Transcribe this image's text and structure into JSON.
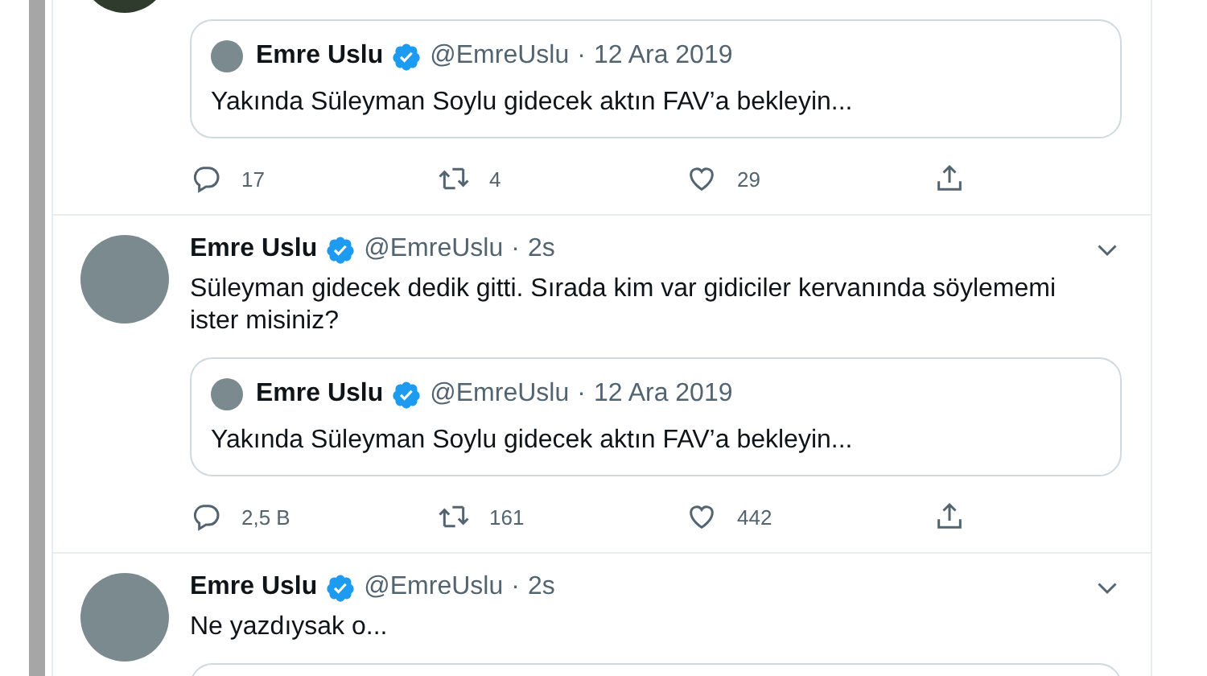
{
  "tweets": [
    {
      "partial": true,
      "quote": {
        "author": "Emre Uslu",
        "handle": "@EmreUslu",
        "sep": "·",
        "date": "12 Ara 2019",
        "text": "Yakında Süleyman Soylu gidecek aktın FAV’a bekleyin..."
      },
      "actions": {
        "replies": "17",
        "retweets": "4",
        "likes": "29"
      }
    },
    {
      "partial": false,
      "author": "Emre Uslu",
      "handle": "@EmreUslu",
      "sep": "·",
      "time": "2s",
      "text": "Süleyman gidecek dedik gitti. Sırada kim var gidiciler kervanında söylememi ister misiniz?",
      "quote": {
        "author": "Emre Uslu",
        "handle": "@EmreUslu",
        "sep": "·",
        "date": "12 Ara 2019",
        "text": "Yakında Süleyman Soylu gidecek aktın FAV’a bekleyin..."
      },
      "actions": {
        "replies": "2,5 B",
        "retweets": "161",
        "likes": "442"
      }
    },
    {
      "partial": false,
      "author": "Emre Uslu",
      "handle": "@EmreUslu",
      "sep": "·",
      "time": "2s",
      "text": "Ne yazdıysak o...",
      "quote_cut": true
    }
  ]
}
